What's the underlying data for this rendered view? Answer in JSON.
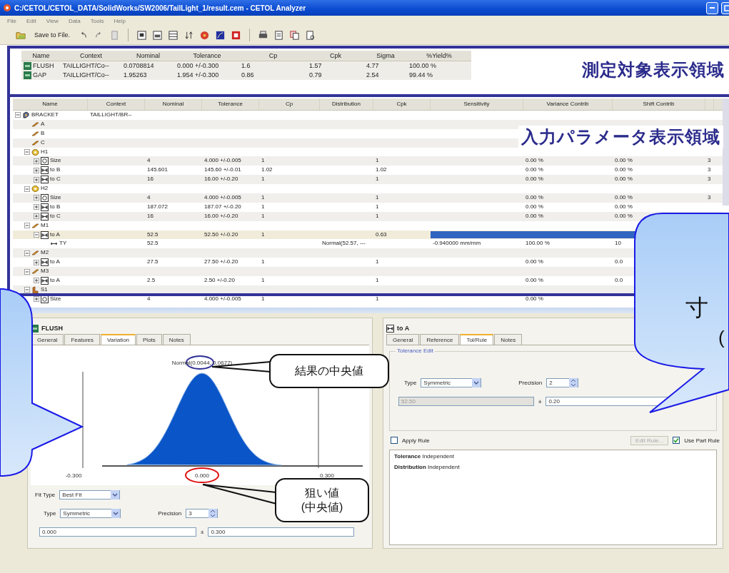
{
  "window": {
    "title": "C:/CETOL/CETOL_DATA/SolidWorks/SW2006/TailLight_1/result.cem - CETOL Analyzer"
  },
  "menu": [
    "File",
    "Edit",
    "View",
    "Data",
    "Tools",
    "Help"
  ],
  "toolbar": {
    "save_label": "Save to File."
  },
  "measurements": {
    "columns": [
      "Name",
      "Context",
      "Nominal",
      "Tolerance",
      "Cp",
      "Cpk",
      "Sigma",
      "%Yield%"
    ],
    "rows": [
      {
        "name": "FLUSH",
        "context": "TAILLIGHT/Co--",
        "nominal": "0.0708814",
        "tolerance": "0.000 +/-0.300",
        "cp": "1.6",
        "cpk": "1.57",
        "sigma": "4.77",
        "yield": "100.00 %"
      },
      {
        "name": "GAP",
        "context": "TAILLIGHT/Co--",
        "nominal": "1.95263",
        "tolerance": "1.954 +/-0.300",
        "cp": "0.86",
        "cpk": "0.79",
        "sigma": "2.54",
        "yield": "99.44 %"
      }
    ]
  },
  "tree": {
    "columns": [
      "Name",
      "Context",
      "Nominal",
      "Tolerance",
      "Cp",
      "Distribution",
      "Cpk",
      "Sensitivity",
      "Variance Contrib",
      "Shift Contrib"
    ],
    "rows": [
      {
        "name": "BRACKET",
        "kind": "assembly",
        "expanded": true,
        "selected": false,
        "context": "TAILLIGHT/BR--",
        "children": [
          {
            "name": "A",
            "kind": "part",
            "selected": false
          },
          {
            "name": "B",
            "kind": "part",
            "selected": false
          },
          {
            "name": "C",
            "kind": "part",
            "selected": false
          },
          {
            "name": "H1",
            "kind": "feature",
            "expanded": true,
            "selected": false,
            "children": [
              {
                "name": "Size",
                "kind": "size",
                "expanded": false,
                "selected": false,
                "nominal": "4",
                "tolerance": "4.000 +/-0.005",
                "cp": "1",
                "cpk": "1",
                "variance_contrib": "0.00 %",
                "shift_contrib": "0.00 %",
                "column_11": "3"
              },
              {
                "name": "to B",
                "kind": "distance",
                "expanded": false,
                "selected": false,
                "nominal": "145.601",
                "tolerance": "145.60 +/-0.01",
                "cp": "1.02",
                "cpk": "1.02",
                "variance_contrib": "0.00 %",
                "shift_contrib": "0.00 %",
                "column_11": "3"
              },
              {
                "name": "to C",
                "kind": "distance",
                "expanded": false,
                "selected": false,
                "nominal": "16",
                "tolerance": "16.00 +/-0.20",
                "cp": "1",
                "cpk": "1",
                "variance_contrib": "0.00 %",
                "shift_contrib": "0.00 %",
                "column_11": "3"
              }
            ]
          },
          {
            "name": "H2",
            "kind": "feature",
            "expanded": true,
            "selected": false,
            "children": [
              {
                "name": "Size",
                "kind": "size",
                "expanded": false,
                "selected": false,
                "nominal": "4",
                "tolerance": "4.000 +/-0.005",
                "cp": "1",
                "cpk": "1",
                "variance_contrib": "0.00 %",
                "shift_contrib": "0.00 %",
                "column_11": "3"
              },
              {
                "name": "to B",
                "kind": "distance",
                "expanded": false,
                "selected": false,
                "nominal": "187.072",
                "tolerance": "187.07 +/-0.20",
                "cp": "1",
                "cpk": "1",
                "variance_contrib": "0.00 %",
                "shift_contrib": "0.00 %"
              },
              {
                "name": "to C",
                "kind": "distance",
                "expanded": false,
                "selected": false,
                "nominal": "16",
                "tolerance": "16.00 +/-0.20",
                "cp": "1",
                "cpk": "1",
                "variance_contrib": "0.00 %",
                "shift_contrib": "0.00 %"
              }
            ]
          },
          {
            "name": "M1",
            "kind": "part",
            "expanded": true,
            "selected": false,
            "children": [
              {
                "name": "to A",
                "kind": "distance",
                "expanded": true,
                "selected": true,
                "nominal": "52.5",
                "tolerance": "52.50 +/-0.20",
                "cp": "1",
                "cpk": "0.63",
                "sensitivity_bar": {
                  "level": 0.95
                },
                "children": [
                  {
                    "name": "TY",
                    "kind": "variable",
                    "selected": false,
                    "nominal": "52.5",
                    "distribution": "Normal(52.57, ---",
                    "sensitivity": "-0.940000 mm/mm",
                    "variance_contrib": "100.00 %",
                    "shift_contrib": "10"
                  }
                ]
              }
            ]
          },
          {
            "name": "M2",
            "kind": "part",
            "expanded": true,
            "selected": false,
            "children": [
              {
                "name": "to A",
                "kind": "distance",
                "expanded": false,
                "selected": false,
                "nominal": "27.5",
                "tolerance": "27.50 +/-0.20",
                "cp": "1",
                "cpk": "1",
                "variance_contrib": "0.00 %",
                "shift_contrib": "0.0"
              }
            ]
          },
          {
            "name": "M3",
            "kind": "part",
            "expanded": true,
            "selected": false,
            "children": [
              {
                "name": "to A",
                "kind": "distance",
                "expanded": false,
                "selected": false,
                "nominal": "2.5",
                "tolerance": "2.50 +/-0.20",
                "cp": "1",
                "cpk": "1",
                "variance_contrib": "0.00 %",
                "shift_contrib": "0.0"
              }
            ]
          },
          {
            "name": "S1",
            "kind": "bracket",
            "expanded": true,
            "selected": false,
            "children": [
              {
                "name": "Size",
                "kind": "size",
                "expanded": false,
                "selected": false,
                "nominal": "4",
                "tolerance": "4.000 +/-0.005",
                "cp": "1",
                "cpk": "1",
                "variance_contrib": "0.00 %"
              }
            ]
          }
        ]
      }
    ]
  },
  "left_panel": {
    "title": "FLUSH",
    "tabs": [
      {
        "label": "General",
        "selected": false
      },
      {
        "label": "Features",
        "selected": false
      },
      {
        "label": "Variation",
        "selected": true
      },
      {
        "label": "Plots",
        "selected": false
      },
      {
        "label": "Notes",
        "selected": false
      }
    ],
    "chart": {
      "label": "Normal(0.0044, 0.0677)",
      "axis_labels": [
        "-0.300",
        "0.000",
        "0.300"
      ]
    },
    "fit_type": {
      "label": "Fit Type",
      "value": "Best Fit"
    },
    "type": {
      "label": "Type",
      "value": "Symmetric"
    },
    "precision": {
      "label": "Precision",
      "value": "3"
    },
    "nominal": "0.000",
    "plus_minus": "±",
    "tolerance": "0.300"
  },
  "right_panel": {
    "title": "to A",
    "tabs": [
      {
        "label": "General",
        "selected": false
      },
      {
        "label": "Reference",
        "selected": false
      },
      {
        "label": "Tol/Rule",
        "selected": true
      },
      {
        "label": "Notes",
        "selected": false
      }
    ],
    "group_title": "Tolerance Edit",
    "type": {
      "label": "Type",
      "value": "Symmetric"
    },
    "precision": {
      "label": "Precision",
      "value": "2"
    },
    "nominal": {
      "value": "52.50",
      "disabled": true
    },
    "plus_minus": "±",
    "tolerance": "0.20",
    "apply_rule": {
      "label": "Apply Rule",
      "checked": false
    },
    "edit_rule": {
      "label": "Edit Rule...",
      "disabled": true
    },
    "use_part_rule": {
      "label": "Use Part Rule",
      "checked": true
    },
    "rules": [
      "**Tolerance** Independent",
      "**Distribution** Independent"
    ]
  },
  "annotations": {
    "measure_label": "測定対象表示領域",
    "input_label": "入力パラメータ表示領域",
    "result_callout": "結果の中央値",
    "target_callout": [
      "狙い値",
      "(中央値)"
    ],
    "dimension_callout": [
      "寸",
      "("
    ]
  }
}
